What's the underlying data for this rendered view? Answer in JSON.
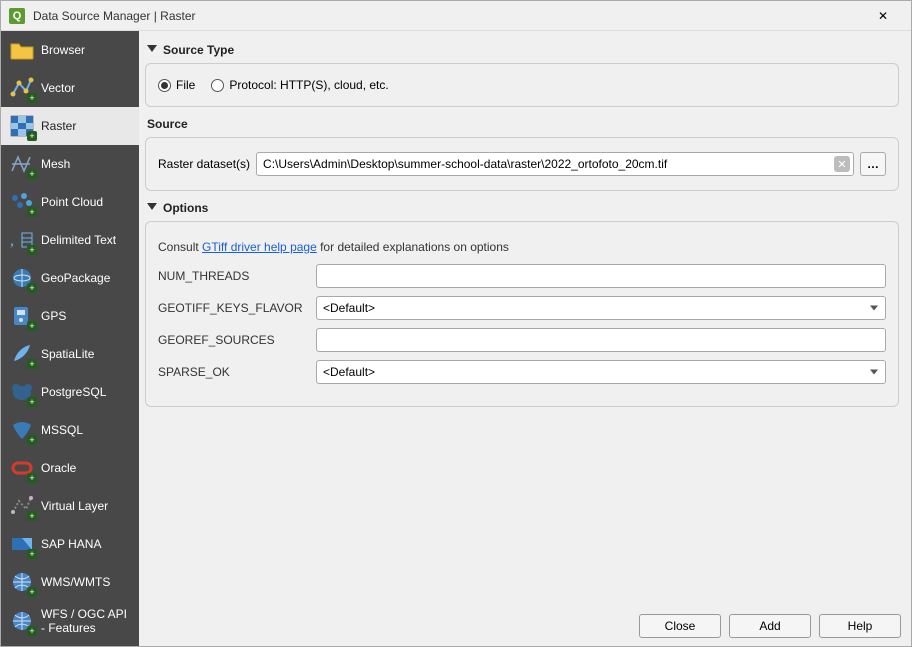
{
  "titlebar": {
    "app_initial": "Q",
    "title": "Data Source Manager | Raster",
    "close_glyph": "✕"
  },
  "sidebar": {
    "items": [
      {
        "label": "Browser",
        "icon": "folder",
        "plus": false
      },
      {
        "label": "Vector",
        "icon": "vector",
        "plus": true
      },
      {
        "label": "Raster",
        "icon": "raster",
        "plus": true
      },
      {
        "label": "Mesh",
        "icon": "mesh",
        "plus": true
      },
      {
        "label": "Point Cloud",
        "icon": "pointcloud",
        "plus": true
      },
      {
        "label": "Delimited Text",
        "icon": "delimited",
        "plus": true
      },
      {
        "label": "GeoPackage",
        "icon": "geopackage",
        "plus": true
      },
      {
        "label": "GPS",
        "icon": "gps",
        "plus": true
      },
      {
        "label": "SpatiaLite",
        "icon": "feather",
        "plus": true
      },
      {
        "label": "PostgreSQL",
        "icon": "elephant",
        "plus": true
      },
      {
        "label": "MSSQL",
        "icon": "mssql",
        "plus": true
      },
      {
        "label": "Oracle",
        "icon": "oracle",
        "plus": true
      },
      {
        "label": "Virtual Layer",
        "icon": "virtual",
        "plus": true
      },
      {
        "label": "SAP HANA",
        "icon": "saphana",
        "plus": true
      },
      {
        "label": "WMS/WMTS",
        "icon": "globe",
        "plus": true
      },
      {
        "label": "WFS / OGC API - Features",
        "icon": "globe",
        "plus": true
      }
    ],
    "selected_index": 2
  },
  "sections": {
    "source_type_title": "Source Type",
    "source_title": "Source",
    "options_title": "Options"
  },
  "source_type": {
    "file_label": "File",
    "protocol_label": "Protocol: HTTP(S), cloud, etc.",
    "selected": "file"
  },
  "source": {
    "label": "Raster dataset(s)",
    "value": "C:\\Users\\Admin\\Desktop\\summer-school-data\\raster\\2022_ortofoto_20cm.tif",
    "browse_label": "…",
    "clear_glyph": "✕"
  },
  "options": {
    "hint_prefix": "Consult ",
    "hint_link_text": "GTiff driver help page",
    "hint_suffix": " for detailed explanations on options",
    "rows": [
      {
        "name": "NUM_THREADS",
        "type": "text",
        "value": ""
      },
      {
        "name": "GEOTIFF_KEYS_FLAVOR",
        "type": "select",
        "value": "<Default>"
      },
      {
        "name": "GEOREF_SOURCES",
        "type": "text",
        "value": ""
      },
      {
        "name": "SPARSE_OK",
        "type": "select",
        "value": "<Default>"
      }
    ]
  },
  "footer": {
    "close": "Close",
    "add": "Add",
    "help": "Help"
  },
  "icons": {
    "plus_glyph": "+"
  }
}
